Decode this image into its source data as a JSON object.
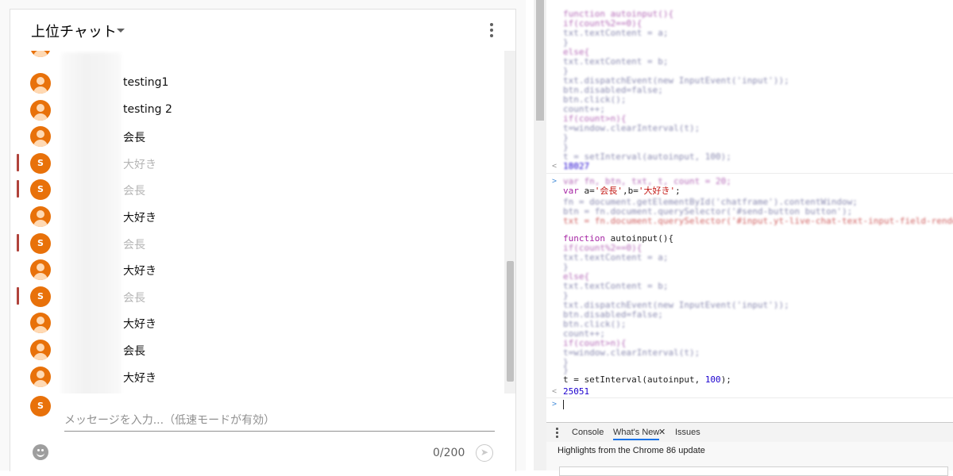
{
  "chat": {
    "title": "上位チャット",
    "messages": [
      {
        "text": "testing1",
        "avatar": "person",
        "faded": false,
        "accent": false
      },
      {
        "text": "testing 2",
        "avatar": "person",
        "faded": false,
        "accent": false
      },
      {
        "text": "会長",
        "avatar": "person",
        "faded": false,
        "accent": false
      },
      {
        "text": "大好き",
        "avatar": "S",
        "faded": true,
        "accent": true
      },
      {
        "text": "会長",
        "avatar": "S",
        "faded": true,
        "accent": true
      },
      {
        "text": "大好き",
        "avatar": "person",
        "faded": false,
        "accent": false
      },
      {
        "text": "会長",
        "avatar": "S",
        "faded": true,
        "accent": true
      },
      {
        "text": "大好き",
        "avatar": "person",
        "faded": false,
        "accent": false
      },
      {
        "text": "会長",
        "avatar": "S",
        "faded": true,
        "accent": true
      },
      {
        "text": "大好き",
        "avatar": "person",
        "faded": false,
        "accent": false
      },
      {
        "text": "会長",
        "avatar": "person",
        "faded": false,
        "accent": false
      },
      {
        "text": "大好き",
        "avatar": "person",
        "faded": false,
        "accent": false
      }
    ],
    "compose_avatar": "S",
    "input_placeholder": "メッセージを入力...（低速モードが有効）",
    "char_count": "0/200",
    "accent_color": "#e8710a"
  },
  "devtools": {
    "code_lines": [
      "var a='会長',b='大好き';",
      "function autoinput(){",
      "t = setInterval(autoinput, 100);"
    ],
    "result": "25051",
    "tabs": [
      "Console",
      "What's New",
      "Issues"
    ],
    "active_tab": "What's New",
    "highlights": "Highlights from the Chrome 86 update"
  }
}
